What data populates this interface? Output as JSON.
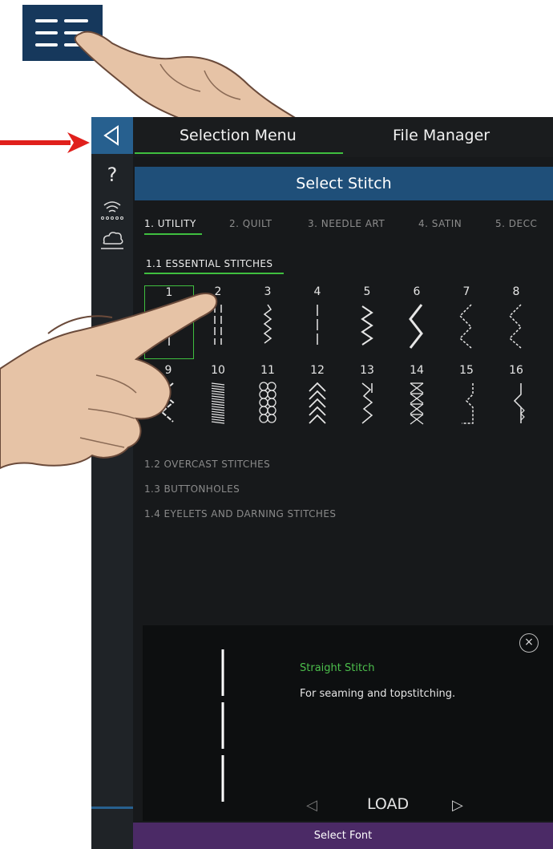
{
  "header": {
    "tab_selection": "Selection Menu",
    "tab_file_manager": "File Manager"
  },
  "select_bar": {
    "label": "Select Stitch"
  },
  "categories": [
    {
      "label": "1. UTILITY",
      "active": true
    },
    {
      "label": "2. QUILT",
      "active": false
    },
    {
      "label": "3. NEEDLE ART",
      "active": false
    },
    {
      "label": "4. SATIN",
      "active": false
    },
    {
      "label": "5. DECC",
      "active": false
    }
  ],
  "section": {
    "title": "1.1 ESSENTIAL STITCHES",
    "stitch_numbers": [
      "1",
      "2",
      "3",
      "4",
      "5",
      "6",
      "7",
      "8",
      "9",
      "10",
      "11",
      "12",
      "13",
      "14",
      "15",
      "16"
    ],
    "selected": "1"
  },
  "subsections": [
    "1.2 OVERCAST STITCHES",
    "1.3 BUTTONHOLES",
    "1.4 EYELETS AND DARNING STITCHES"
  ],
  "info": {
    "title": "Straight Stitch",
    "description": "For seaming and topstitching.",
    "load_label": "LOAD",
    "close_glyph": "×"
  },
  "font_bar": {
    "label": "Select Font"
  },
  "sidebar": {
    "help_glyph": "?"
  },
  "colors": {
    "accent_green": "#3fbf3f",
    "select_bar_blue": "#1f4f79",
    "font_bar_purple": "#4b2a66",
    "arrow_red": "#e0201c"
  }
}
